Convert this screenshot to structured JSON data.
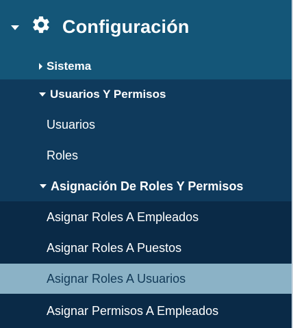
{
  "header": {
    "title": "Configuración",
    "icon": "gear-icon",
    "expanded": true
  },
  "items": {
    "sistema": {
      "label": "Sistema",
      "expanded": false
    },
    "usuarios_permisos": {
      "label": "Usuarios Y Permisos",
      "expanded": true,
      "children": {
        "usuarios": "Usuarios",
        "roles": "Roles"
      }
    },
    "asignacion": {
      "label": "Asignación De Roles Y Permisos",
      "expanded": true,
      "children": [
        "Asignar Roles A Empleados",
        "Asignar Roles A Puestos",
        "Asignar Roles A Usuarios",
        "Asignar Permisos A Empleados"
      ],
      "active_index": 2
    }
  },
  "colors": {
    "header_bg": "#145678",
    "section_bg": "#0f3a5c",
    "deep_bg": "#0a2a47",
    "active_bg": "#8bb2c6",
    "active_text": "#123a58"
  }
}
